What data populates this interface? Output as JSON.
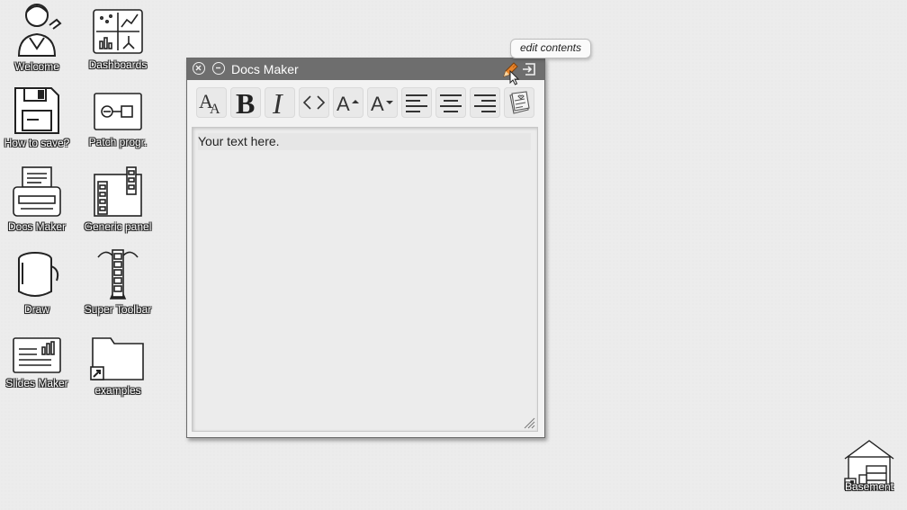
{
  "desktop": {
    "icons": [
      {
        "label": "Welcome",
        "icon": "person-icon"
      },
      {
        "label": "Dashboards",
        "icon": "dashboard-icon"
      },
      {
        "label": "How to save?",
        "icon": "floppy-icon"
      },
      {
        "label": "Patch progr.",
        "icon": "patch-icon"
      },
      {
        "label": "Docs Maker",
        "icon": "typewriter-icon"
      },
      {
        "label": "Generic panel",
        "icon": "panel-icon"
      },
      {
        "label": "Draw",
        "icon": "paint-bucket-icon"
      },
      {
        "label": "Super Toolbar",
        "icon": "super-toolbar-icon"
      },
      {
        "label": "Slides Maker",
        "icon": "slides-icon"
      },
      {
        "label": "examples",
        "icon": "folder-shortcut-icon"
      },
      {
        "label": "Basement",
        "icon": "basement-icon"
      }
    ]
  },
  "window": {
    "title": "Docs Maker",
    "close_icon": "close-icon",
    "minimize_icon": "minimize-icon",
    "edit_icon": "pencil-icon",
    "exit_icon": "exit-icon",
    "tooltip": "edit contents"
  },
  "toolbar": {
    "tools": [
      {
        "name": "font-size-icon",
        "glyph": "AA"
      },
      {
        "name": "bold-icon",
        "glyph": "B"
      },
      {
        "name": "italic-icon",
        "glyph": "I"
      },
      {
        "name": "code-icon",
        "glyph": "<>"
      },
      {
        "name": "increase-font-icon",
        "glyph": "A▴"
      },
      {
        "name": "decrease-font-icon",
        "glyph": "A▾"
      },
      {
        "name": "align-left-icon"
      },
      {
        "name": "align-center-icon"
      },
      {
        "name": "align-right-icon"
      },
      {
        "name": "notes-icon"
      }
    ]
  },
  "editor": {
    "text": "Your text here."
  },
  "colors": {
    "titlebar": "#6e6e6e",
    "desktop": "#ececec",
    "pencil": "#e8842a"
  }
}
